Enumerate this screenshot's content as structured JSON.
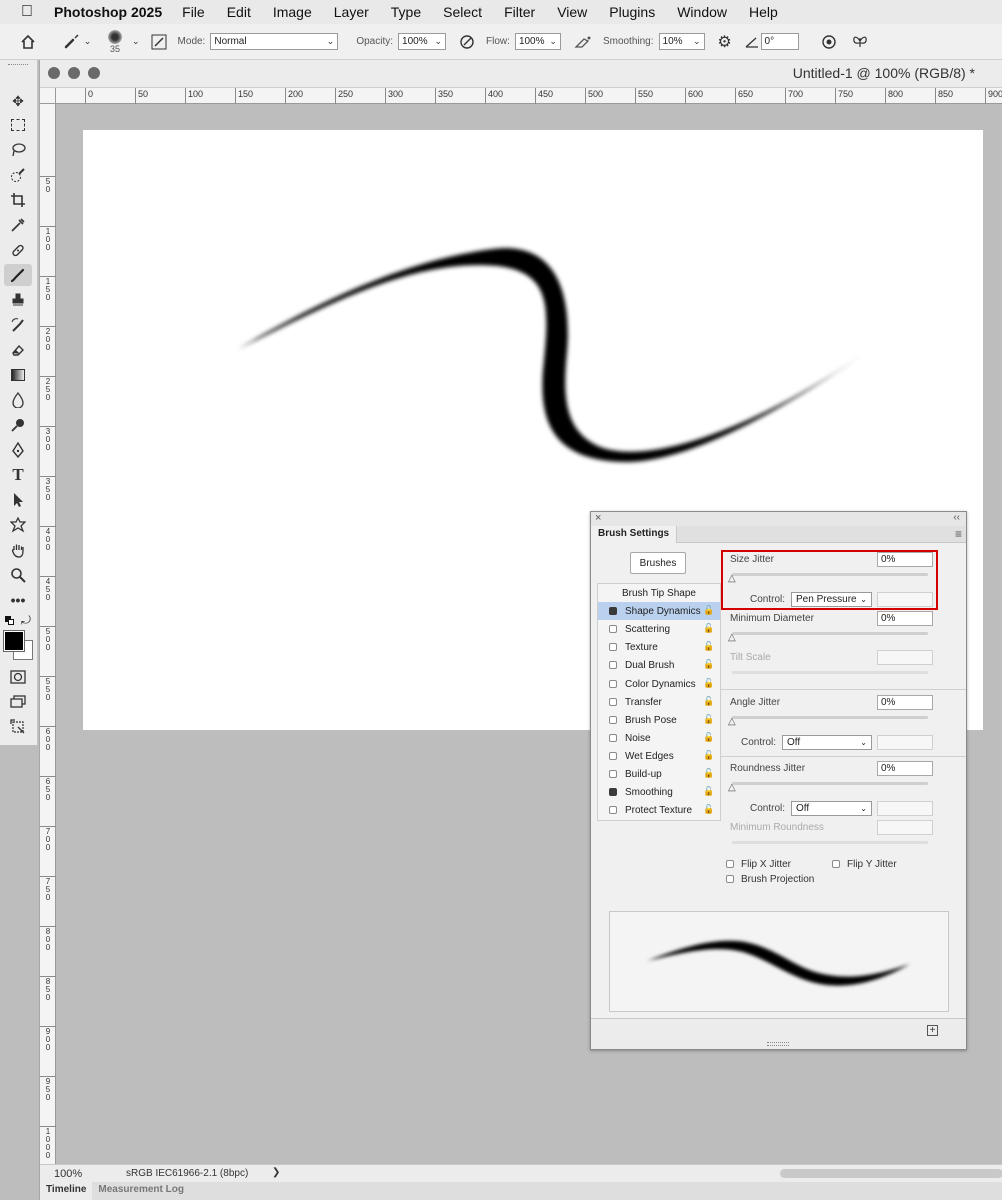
{
  "menubar": {
    "app_name": "Photoshop 2025",
    "items": [
      "File",
      "Edit",
      "Image",
      "Layer",
      "Type",
      "Select",
      "Filter",
      "View",
      "Plugins",
      "Window",
      "Help"
    ]
  },
  "options": {
    "brush_size": "35",
    "mode_label": "Mode:",
    "mode_value": "Normal",
    "opacity_label": "Opacity:",
    "opacity_value": "100%",
    "flow_label": "Flow:",
    "flow_value": "100%",
    "smoothing_label": "Smoothing:",
    "smoothing_value": "10%",
    "angle_value": "0°"
  },
  "document": {
    "title": "Untitled-1 @ 100% (RGB/8) *",
    "ruler_h": [
      "0",
      "50",
      "100",
      "150",
      "200",
      "250",
      "300",
      "350",
      "400",
      "450",
      "500",
      "550",
      "600",
      "650",
      "700",
      "750",
      "800",
      "850",
      "900"
    ],
    "ruler_v": [
      "5\n0",
      "1\n0\n0",
      "1\n5\n0",
      "2\n0\n0",
      "2\n5\n0",
      "3\n0\n0",
      "3\n5\n0",
      "4\n0\n0",
      "4\n5\n0",
      "5\n0\n0",
      "5\n5\n0",
      "6\n0\n0",
      "6\n5\n0",
      "7\n0\n0",
      "7\n5\n0",
      "8\n0\n0",
      "8\n5\n0",
      "9\n0\n0",
      "9\n5\n0",
      "1\n0\n0\n0"
    ],
    "zoom": "100%",
    "profile": "sRGB IEC61966-2.1 (8bpc)",
    "status_arrow": "❯"
  },
  "bottom_tabs": [
    "Timeline",
    "Measurement Log"
  ],
  "panel": {
    "close": "×",
    "collapse": "‹‹",
    "menu": "≡",
    "tab": "Brush Settings",
    "brushes_button": "Brushes",
    "list": [
      {
        "label": "Brush Tip Shape",
        "checkbox": false,
        "checked": false,
        "lock": false,
        "selected": false
      },
      {
        "label": "Shape Dynamics",
        "checkbox": true,
        "checked": true,
        "lock": true,
        "selected": true
      },
      {
        "label": "Scattering",
        "checkbox": true,
        "checked": false,
        "lock": true,
        "selected": false
      },
      {
        "label": "Texture",
        "checkbox": true,
        "checked": false,
        "lock": true,
        "selected": false
      },
      {
        "label": "Dual Brush",
        "checkbox": true,
        "checked": false,
        "lock": true,
        "selected": false
      },
      {
        "label": "Color Dynamics",
        "checkbox": true,
        "checked": false,
        "lock": true,
        "selected": false
      },
      {
        "label": "Transfer",
        "checkbox": true,
        "checked": false,
        "lock": true,
        "selected": false
      },
      {
        "label": "Brush Pose",
        "checkbox": true,
        "checked": false,
        "lock": true,
        "selected": false
      },
      {
        "label": "Noise",
        "checkbox": true,
        "checked": false,
        "lock": true,
        "selected": false
      },
      {
        "label": "Wet Edges",
        "checkbox": true,
        "checked": false,
        "lock": true,
        "selected": false
      },
      {
        "label": "Build-up",
        "checkbox": true,
        "checked": false,
        "lock": true,
        "selected": false
      },
      {
        "label": "Smoothing",
        "checkbox": true,
        "checked": true,
        "lock": true,
        "selected": false
      },
      {
        "label": "Protect Texture",
        "checkbox": true,
        "checked": false,
        "lock": true,
        "selected": false
      }
    ],
    "size_jitter_label": "Size Jitter",
    "size_jitter_value": "0%",
    "control_label": "Control:",
    "size_control_value": "Pen Pressure",
    "min_diameter_label": "Minimum Diameter",
    "min_diameter_value": "0%",
    "tilt_scale_label": "Tilt Scale",
    "angle_jitter_label": "Angle Jitter",
    "angle_jitter_value": "0%",
    "angle_control_value": "Off",
    "roundness_jitter_label": "Roundness Jitter",
    "roundness_jitter_value": "0%",
    "roundness_control_value": "Off",
    "min_roundness_label": "Minimum Roundness",
    "flip_x_label": "Flip X Jitter",
    "flip_y_label": "Flip Y Jitter",
    "projection_label": "Brush Projection"
  },
  "colors": {
    "highlight": "#d40000",
    "selection": "#b9d1ee"
  }
}
